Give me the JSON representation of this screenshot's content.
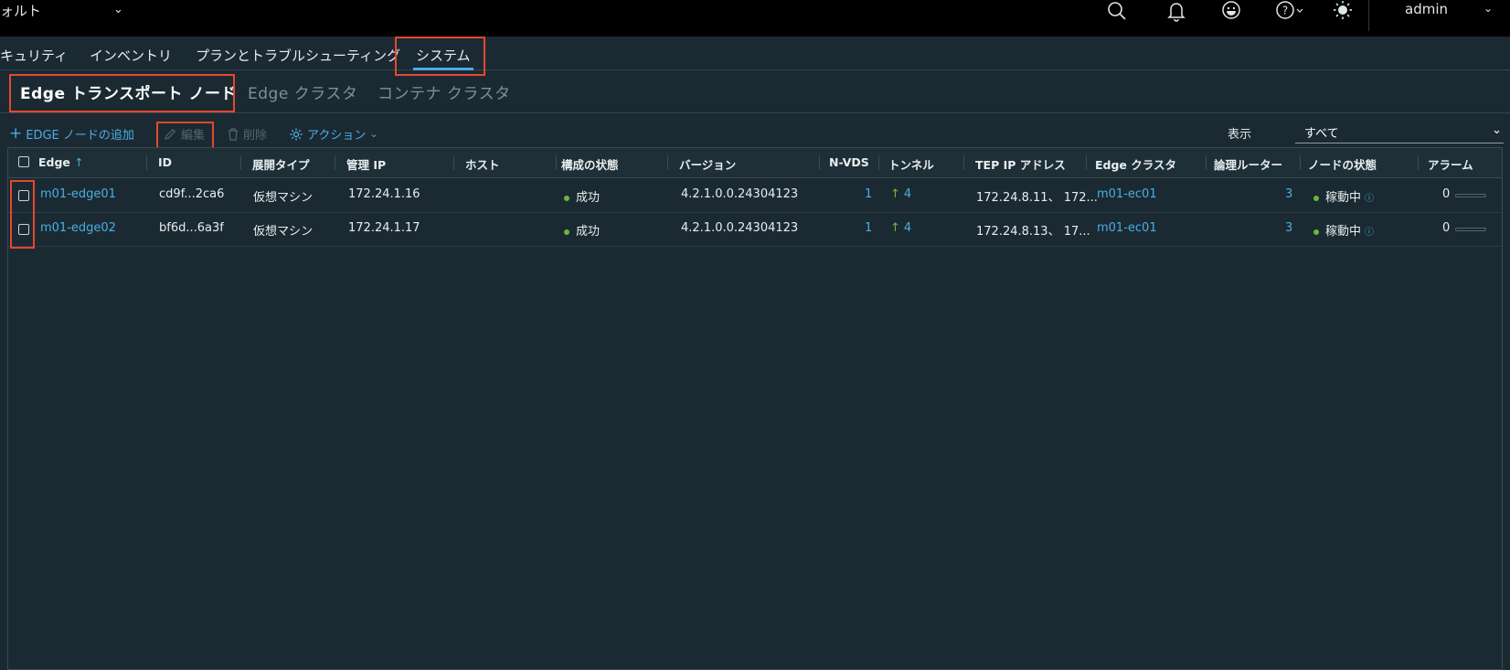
{
  "topbar": {
    "workspace_label": "ォルト",
    "user": "admin",
    "icons": [
      "search-icon",
      "bell-icon",
      "smiley-icon",
      "help-icon",
      "theme-icon"
    ]
  },
  "nav": {
    "tabs": [
      {
        "label": "キュリティ"
      },
      {
        "label": "インベントリ"
      },
      {
        "label": "プランとトラブルシューティング"
      },
      {
        "label": "システム",
        "active": true
      }
    ]
  },
  "subtabs": [
    {
      "label": "Edge トランスポート ノード",
      "active": true
    },
    {
      "label": "Edge クラスタ"
    },
    {
      "label": "コンテナ クラスタ"
    }
  ],
  "toolbar": {
    "add": "EDGE ノードの追加",
    "edit": "編集",
    "delete": "削除",
    "actions": "アクション",
    "show_label": "表示",
    "show_value": "すべて"
  },
  "table": {
    "columns": [
      "Edge",
      "ID",
      "展開タイプ",
      "管理 IP",
      "ホスト",
      "構成の状態",
      "バージョン",
      "N-VDS",
      "トンネル",
      "TEP IP アドレス",
      "Edge クラスタ",
      "論理ルーター",
      "ノードの状態",
      "アラーム"
    ],
    "rows": [
      {
        "edge": "m01-edge01",
        "id": "cd9f...2ca6",
        "type": "仮想マシン",
        "ip": "172.24.1.16",
        "host": "",
        "config": "成功",
        "version": "4.2.1.0.0.24304123",
        "nvds": "1",
        "tunnel": "4",
        "tep": "172.24.8.11、 172...",
        "cluster": "m01-ec01",
        "routers": "3",
        "node_status": "稼動中",
        "alarms": "0"
      },
      {
        "edge": "m01-edge02",
        "id": "bf6d...6a3f",
        "type": "仮想マシン",
        "ip": "172.24.1.17",
        "host": "",
        "config": "成功",
        "version": "4.2.1.0.0.24304123",
        "nvds": "1",
        "tunnel": "4",
        "tep": "172.24.8.13、 17...",
        "cluster": "m01-ec01",
        "routers": "3",
        "node_status": "稼動中",
        "alarms": "0"
      }
    ]
  },
  "colors": {
    "accent": "#49aee4",
    "highlight": "#e5472d",
    "success": "#6bb83a"
  }
}
